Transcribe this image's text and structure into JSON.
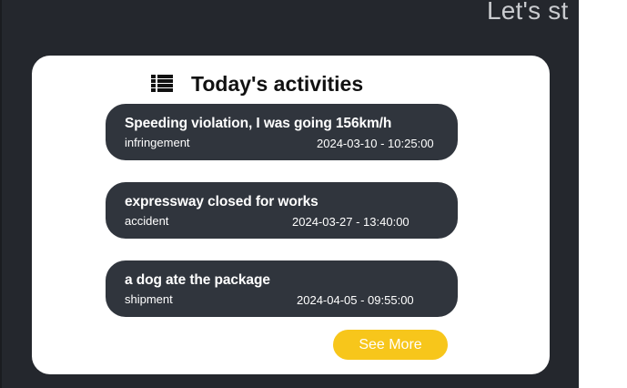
{
  "header": {
    "welcome_text": "Let's st"
  },
  "activities_card": {
    "title": "Today's activities",
    "icon": "list-icon",
    "items": [
      {
        "title": "Speeding violation, I was going 156km/h",
        "type": "infringement",
        "datetime": "2024-03-10 - 10:25:00"
      },
      {
        "title": "expressway closed for works",
        "type": "accident",
        "datetime": "2024-03-27 - 13:40:00"
      },
      {
        "title": "a dog ate the package",
        "type": "shipment",
        "datetime": "2024-04-05 - 09:55:00"
      }
    ],
    "see_more_label": "See More"
  },
  "colors": {
    "background": "#24272d",
    "card": "#ffffff",
    "activity_item": "#30353d",
    "accent": "#f7c61b"
  }
}
